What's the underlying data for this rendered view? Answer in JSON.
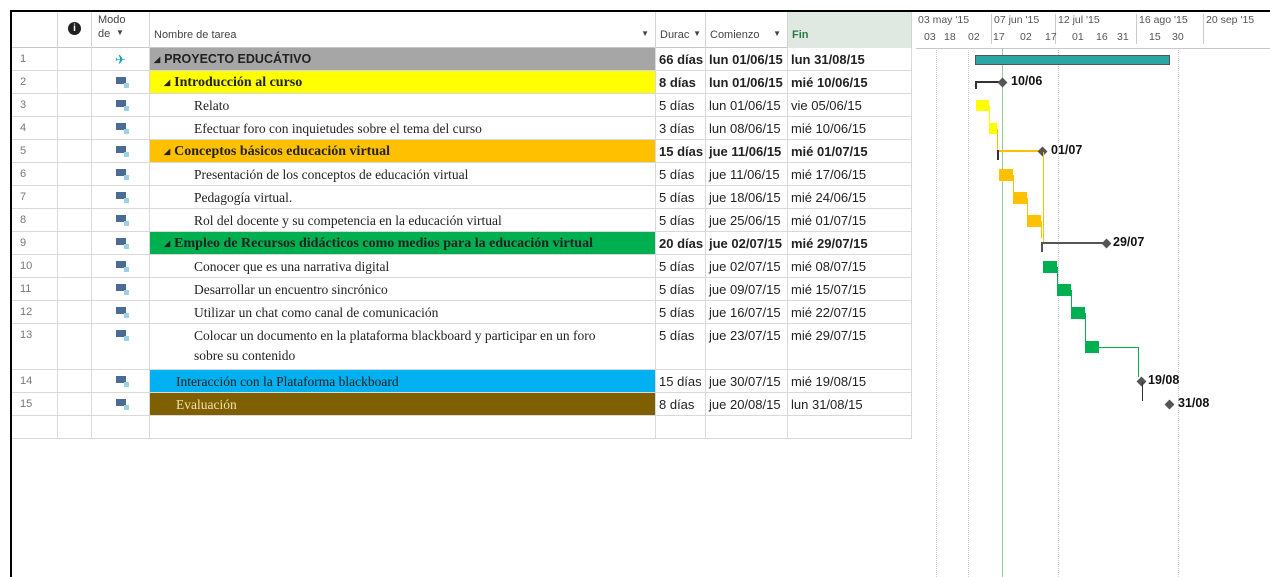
{
  "headers": {
    "info_icon": "info-icon",
    "mode_line1": "Modo",
    "mode_line2": "de",
    "name": "Nombre de tarea",
    "duration": "Durac",
    "start": "Comienzo",
    "finish": "Fin"
  },
  "timescale": {
    "top": [
      "03 may '15",
      "07 jun '15",
      "12 jul '15",
      "16 ago '15",
      "20 sep '15"
    ],
    "bottom": [
      "03",
      "18",
      "02",
      "17",
      "02",
      "17",
      "01",
      "16",
      "31",
      "15",
      "30"
    ]
  },
  "colors": {
    "project": "#a6a6a6",
    "intro": "#ffff00",
    "conceptos": "#ffc000",
    "empleo": "#00b050",
    "interaccion": "#00b0f0",
    "evaluacion": "#7f6000",
    "project_bar": "#2aa6a4",
    "task_intro": "#ffff00",
    "task_conceptos": "#ffc000",
    "task_empleo": "#00b050"
  },
  "rows": [
    {
      "id": "1",
      "name": "PROYECTO EDUCÁTIVO",
      "duration": "66 días",
      "start": "lun 01/06/15",
      "finish": "lun 31/08/15",
      "summary": true,
      "collapse": "◢",
      "fill": "#a6a6a6",
      "pin": true
    },
    {
      "id": "2",
      "name": "Introducción al curso",
      "duration": "8 días",
      "start": "lun 01/06/15",
      "finish": "mié 10/06/15",
      "summary": true,
      "collapse": "◢",
      "fill": "#ffff00"
    },
    {
      "id": "3",
      "name": "Relato",
      "duration": "5 días",
      "start": "lun 01/06/15",
      "finish": "vie 05/06/15"
    },
    {
      "id": "4",
      "name": "Efectuar foro con inquietudes sobre el tema del curso",
      "duration": "3 días",
      "start": "lun 08/06/15",
      "finish": "mié 10/06/15"
    },
    {
      "id": "5",
      "name": "Conceptos básicos educación virtual",
      "duration": "15 días",
      "start": "jue 11/06/15",
      "finish": "mié 01/07/15",
      "summary": true,
      "collapse": "◢",
      "fill": "#ffc000"
    },
    {
      "id": "6",
      "name": "Presentación de los conceptos de educación virtual",
      "duration": "5 días",
      "start": "jue 11/06/15",
      "finish": "mié 17/06/15"
    },
    {
      "id": "7",
      "name": "Pedagogía virtual.",
      "duration": "5 días",
      "start": "jue 18/06/15",
      "finish": "mié 24/06/15"
    },
    {
      "id": "8",
      "name": "Rol del docente y su competencia en la educación virtual",
      "duration": "5 días",
      "start": "jue 25/06/15",
      "finish": "mié 01/07/15"
    },
    {
      "id": "9",
      "name": "Empleo de Recursos didácticos como medios para la educación virtual",
      "duration": "20 días",
      "start": "jue 02/07/15",
      "finish": "mié 29/07/15",
      "summary": true,
      "collapse": "◢",
      "fill": "#00b050"
    },
    {
      "id": "10",
      "name": "Conocer que es una narrativa digital",
      "duration": "5 días",
      "start": "jue 02/07/15",
      "finish": "mié 08/07/15"
    },
    {
      "id": "11",
      "name": "Desarrollar un encuentro sincrónico",
      "duration": "5 días",
      "start": "jue 09/07/15",
      "finish": "mié 15/07/15"
    },
    {
      "id": "12",
      "name": "Utilizar un chat como canal de comunicación",
      "duration": "5 días",
      "start": "jue 16/07/15",
      "finish": "mié 22/07/15"
    },
    {
      "id": "13",
      "name": "Colocar un documento en la plataforma blackboard y participar  en un  foro",
      "name2": "sobre su contenido",
      "duration": "5 días",
      "start": "jue 23/07/15",
      "finish": "mié 29/07/15"
    },
    {
      "id": "14",
      "name": "Interacción con la Plataforma blackboard",
      "duration": "15 días",
      "start": "jue 30/07/15",
      "finish": "mié 19/08/15",
      "fill": "#00b0f0"
    },
    {
      "id": "15",
      "name": "Evaluación",
      "duration": "8 días",
      "start": "jue 20/08/15",
      "finish": "lun 31/08/15",
      "fill": "#7f6000",
      "light": true
    }
  ],
  "milestones": [
    "10/06",
    "01/07",
    "29/07",
    "19/08",
    "31/08"
  ]
}
